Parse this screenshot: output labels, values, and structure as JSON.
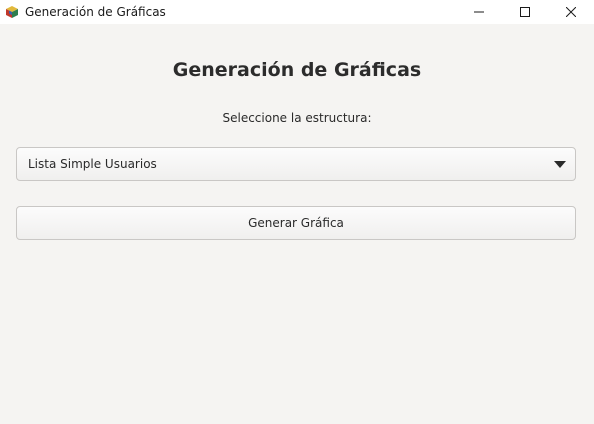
{
  "window": {
    "title": "Generación de Gráficas",
    "app_icon": "colorful-cube-icon",
    "controls": {
      "minimize": "minimize-icon",
      "maximize": "maximize-icon",
      "close": "close-icon"
    }
  },
  "main": {
    "heading": "Generación de Gráficas",
    "structure_prompt": "Seleccione la estructura:",
    "structure_select": {
      "selected": "Lista Simple Usuarios",
      "arrow_icon": "caret-down-icon"
    },
    "generate_button_label": "Generar Gráfica"
  },
  "colors": {
    "background": "#f5f4f2",
    "titlebar": "#ffffff",
    "border": "#c9c7c5"
  }
}
